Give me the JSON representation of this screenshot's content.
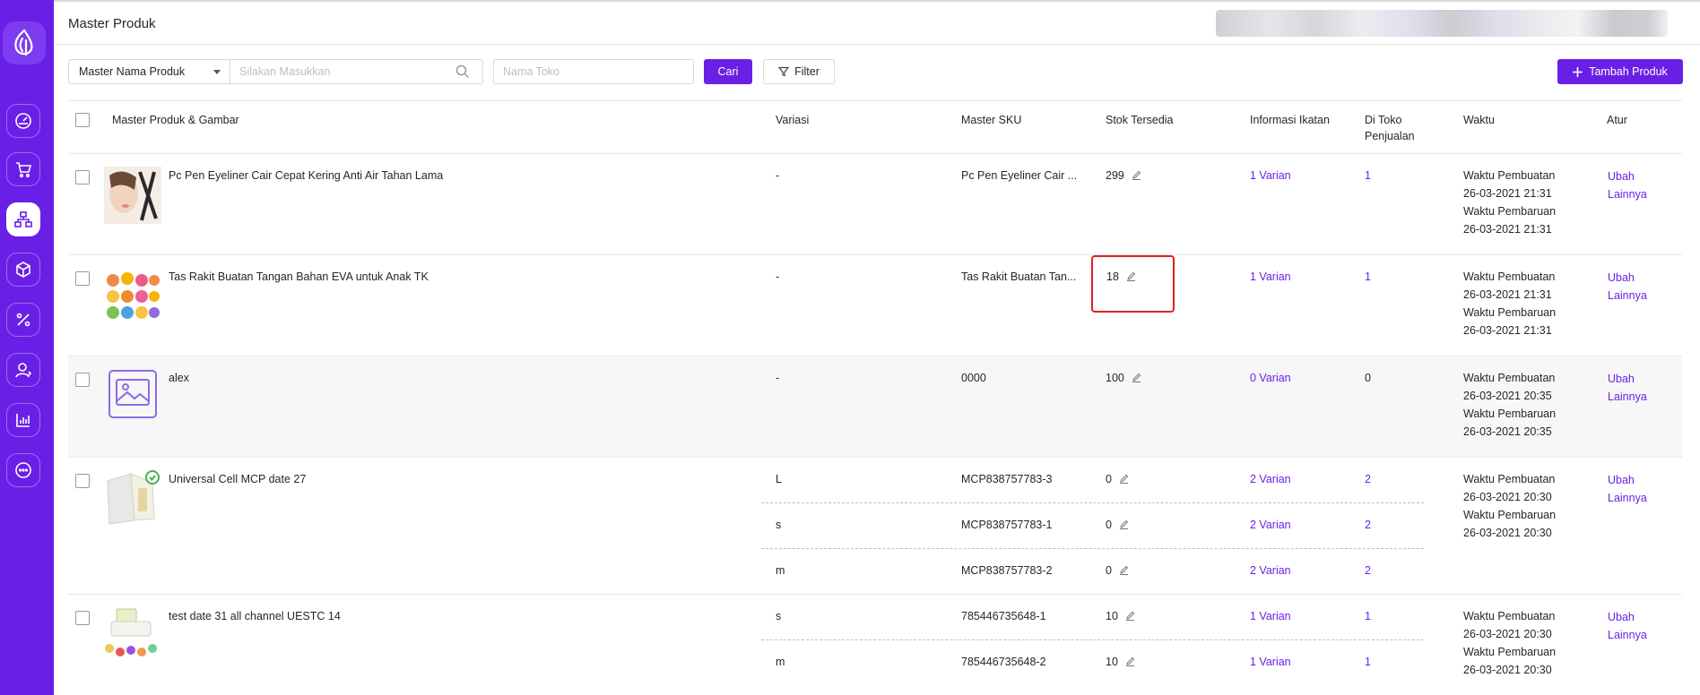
{
  "sidebar": {
    "items": [
      {
        "icon": "dashboard-icon",
        "active": false
      },
      {
        "icon": "cart-icon",
        "active": false
      },
      {
        "icon": "product-tree-icon",
        "active": true
      },
      {
        "icon": "box-icon",
        "active": false
      },
      {
        "icon": "percent-icon",
        "active": false
      },
      {
        "icon": "customer-icon",
        "active": false
      },
      {
        "icon": "chart-icon",
        "active": false
      },
      {
        "icon": "chat-icon",
        "active": false
      }
    ],
    "brand_color": "#6a1fe6"
  },
  "header": {
    "title": "Master Produk"
  },
  "toolbar": {
    "select_value": "Master Nama Produk",
    "search_placeholder": "Silakan Masukkan",
    "store_placeholder": "Nama Toko",
    "search_button": "Cari",
    "filter_button": "Filter",
    "add_button": "Tambah Produk"
  },
  "table": {
    "columns": [
      "Master Produk & Gambar",
      "Variasi",
      "Master SKU",
      "Stok Tersedia",
      "Informasi Ikatan",
      "Di Toko Penjualan",
      "Waktu",
      "Atur"
    ],
    "labels": {
      "created": "Waktu Pembuatan",
      "updated": "Waktu Pembaruan",
      "edit": "Ubah",
      "more": "Lainnya"
    },
    "rows": [
      {
        "name": "Pc Pen Eyeliner Cair Cepat Kering Anti Air Tahan Lama",
        "image": "eyeliner-photo",
        "created": "26-03-2021 21:31",
        "updated": "26-03-2021 21:31",
        "variants": [
          {
            "variasi": "-",
            "sku": "Pc Pen Eyeliner Cair ...",
            "stock": "299",
            "binding": "1 Varian",
            "stores": "1"
          }
        ]
      },
      {
        "name": "Tas Rakit Buatan Tangan Bahan EVA untuk Anak TK",
        "image": "eva-bag-photo",
        "created": "26-03-2021 21:31",
        "updated": "26-03-2021 21:31",
        "variants": [
          {
            "variasi": "-",
            "sku": "Tas Rakit Buatan Tan...",
            "stock": "18",
            "binding": "1 Varian",
            "stores": "1"
          }
        ]
      },
      {
        "name": "alex",
        "image": "placeholder-image-icon",
        "created": "26-03-2021 20:35",
        "updated": "26-03-2021 20:35",
        "variants": [
          {
            "variasi": "-",
            "sku": "0000",
            "stock": "100",
            "binding": "0 Varian",
            "stores": "0"
          }
        ]
      },
      {
        "name": "Universal Cell MCP date 27",
        "image": "universal-cell-photo",
        "created": "26-03-2021 20:30",
        "updated": "26-03-2021 20:30",
        "variants": [
          {
            "variasi": "L",
            "sku": "MCP838757783-3",
            "stock": "0",
            "binding": "2 Varian",
            "stores": "2"
          },
          {
            "variasi": "s",
            "sku": "MCP838757783-1",
            "stock": "0",
            "binding": "2 Varian",
            "stores": "2"
          },
          {
            "variasi": "m",
            "sku": "MCP838757783-2",
            "stock": "0",
            "binding": "2 Varian",
            "stores": "2"
          }
        ]
      },
      {
        "name": "test date 31 all channel UESTC 14",
        "image": "juicer-set-photo",
        "created": "26-03-2021 20:30",
        "updated": "26-03-2021 20:30",
        "variants": [
          {
            "variasi": "s",
            "sku": "785446735648-1",
            "stock": "10",
            "binding": "1 Varian",
            "stores": "1"
          },
          {
            "variasi": "m",
            "sku": "785446735648-2",
            "stock": "10",
            "binding": "1 Varian",
            "stores": "1"
          }
        ]
      }
    ]
  }
}
